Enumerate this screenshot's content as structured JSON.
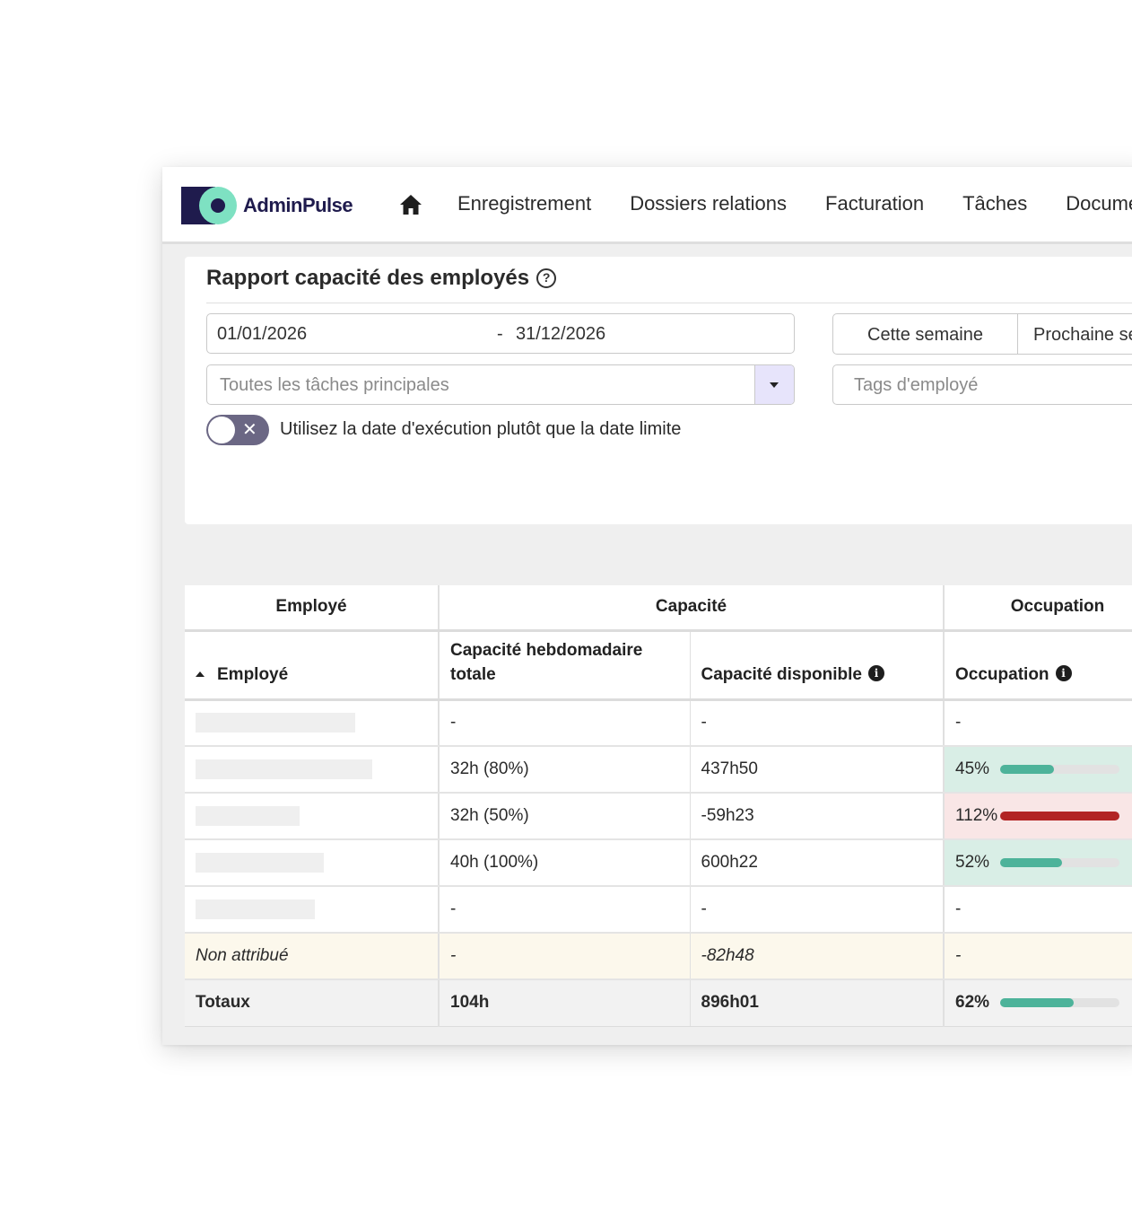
{
  "app": {
    "name": "AdminPulse"
  },
  "nav": {
    "items": [
      "Enregistrement",
      "Dossiers relations",
      "Facturation",
      "Tâches",
      "Documents"
    ]
  },
  "report": {
    "title": "Rapport capacité des employés",
    "date_from": "01/01/2026",
    "date_separator": "-",
    "date_to": "31/12/2026",
    "quick_ranges": [
      "Cette semaine",
      "Prochaine semaine"
    ],
    "task_select_placeholder": "Toutes les tâches principales",
    "tags_placeholder": "Tags d'employé",
    "toggle_label": "Utilisez la date d'exécution plutôt que la date limite",
    "toggle_on": false
  },
  "table": {
    "groups": [
      "Employé",
      "Capacité",
      "Occupation"
    ],
    "columns": [
      "Employé",
      "Capacité hebdomadaire totale",
      "Capacité disponible",
      "Occupation"
    ],
    "sort": {
      "column": "Employé",
      "direction": "ascending"
    },
    "rows": [
      {
        "weekly": "-",
        "available": "-",
        "occupation": "-"
      },
      {
        "weekly": "32h (80%)",
        "available": "437h50",
        "occupation": "45%",
        "occupation_value": 45,
        "status": "ok"
      },
      {
        "weekly": "32h (50%)",
        "available": "-59h23",
        "occupation": "112%",
        "occupation_value": 112,
        "status": "over"
      },
      {
        "weekly": "40h (100%)",
        "available": "600h22",
        "occupation": "52%",
        "occupation_value": 52,
        "status": "ok"
      },
      {
        "weekly": "-",
        "available": "-",
        "occupation": "-"
      }
    ],
    "unassigned": {
      "label": "Non attribué",
      "weekly": "-",
      "available": "-82h48",
      "occupation": "-"
    },
    "totals": {
      "label": "Totaux",
      "weekly": "104h",
      "available": "896h01",
      "occupation": "62%",
      "occupation_value": 62
    }
  },
  "colors": {
    "brand_dark": "#1f1b4d",
    "brand_mint": "#7ee1c2",
    "bar_ok": "#4db39a",
    "bar_over": "#b22424",
    "cell_ok": "#d9eee6",
    "cell_over": "#f9e6e6"
  },
  "icons": {
    "home": "home-icon",
    "help": "question-circle-icon",
    "info": "info-circle-icon",
    "dropdown": "caret-down-icon",
    "toggle_off": "x-icon"
  }
}
